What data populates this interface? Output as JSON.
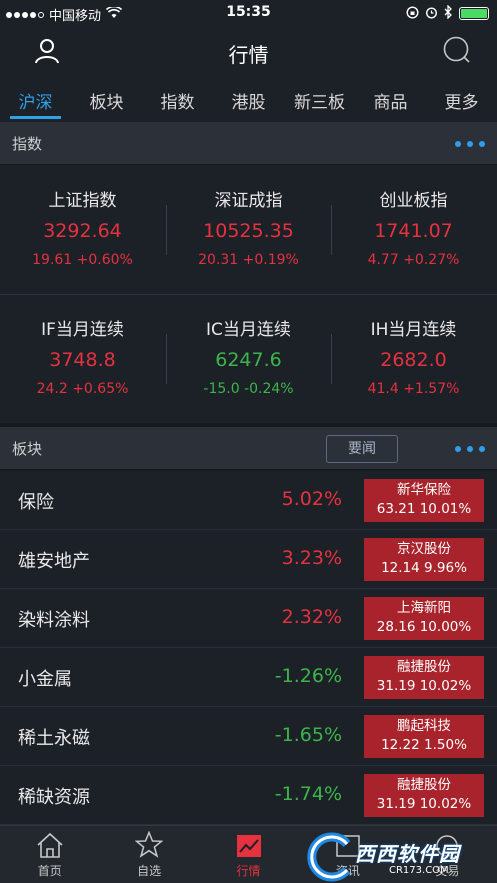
{
  "status_bar": {
    "carrier": "中国移动",
    "time": "15:35"
  },
  "header": {
    "title": "行情"
  },
  "tabs": [
    "沪深",
    "板块",
    "指数",
    "港股",
    "新三板",
    "商品",
    "更多"
  ],
  "index_section": {
    "label": "指数"
  },
  "indices": [
    {
      "name": "上证指数",
      "price": "3292.64",
      "change": "19.61 +0.60%",
      "dir": "up"
    },
    {
      "name": "深证成指",
      "price": "10525.35",
      "change": "20.31 +0.19%",
      "dir": "up"
    },
    {
      "name": "创业板指",
      "price": "1741.07",
      "change": "4.77 +0.27%",
      "dir": "up"
    },
    {
      "name": "IF当月连续",
      "price": "3748.8",
      "change": "24.2 +0.65%",
      "dir": "up"
    },
    {
      "name": "IC当月连续",
      "price": "6247.6",
      "change": "-15.0 -0.24%",
      "dir": "down"
    },
    {
      "name": "IH当月连续",
      "price": "2682.0",
      "change": "41.4 +1.57%",
      "dir": "up"
    }
  ],
  "sector_section": {
    "label": "板块",
    "news_button": "要闻"
  },
  "sectors": [
    {
      "name": "保险",
      "pct": "5.02%",
      "dir": "up",
      "leader_name": "新华保险",
      "leader_stats": "63.21 10.01%"
    },
    {
      "name": "雄安地产",
      "pct": "3.23%",
      "dir": "up",
      "leader_name": "京汉股份",
      "leader_stats": "12.14 9.96%"
    },
    {
      "name": "染料涂料",
      "pct": "2.32%",
      "dir": "up",
      "leader_name": "上海新阳",
      "leader_stats": "28.16 10.00%"
    },
    {
      "name": "小金属",
      "pct": "-1.26%",
      "dir": "down",
      "leader_name": "融捷股份",
      "leader_stats": "31.19 10.02%"
    },
    {
      "name": "稀土永磁",
      "pct": "-1.65%",
      "dir": "down",
      "leader_name": "鹏起科技",
      "leader_stats": "12.22 1.50%"
    },
    {
      "name": "稀缺资源",
      "pct": "-1.74%",
      "dir": "down",
      "leader_name": "融捷股份",
      "leader_stats": "31.19 10.02%"
    }
  ],
  "tab_bar": [
    "首页",
    "自选",
    "行情",
    "资讯",
    "交易"
  ],
  "watermark": {
    "text": "西西软件园",
    "url": "CR173.COM"
  },
  "colors": {
    "up": "#e5323e",
    "down": "#3db54a",
    "accent": "#2f9fe8",
    "leader_bg": "#a8232b"
  }
}
